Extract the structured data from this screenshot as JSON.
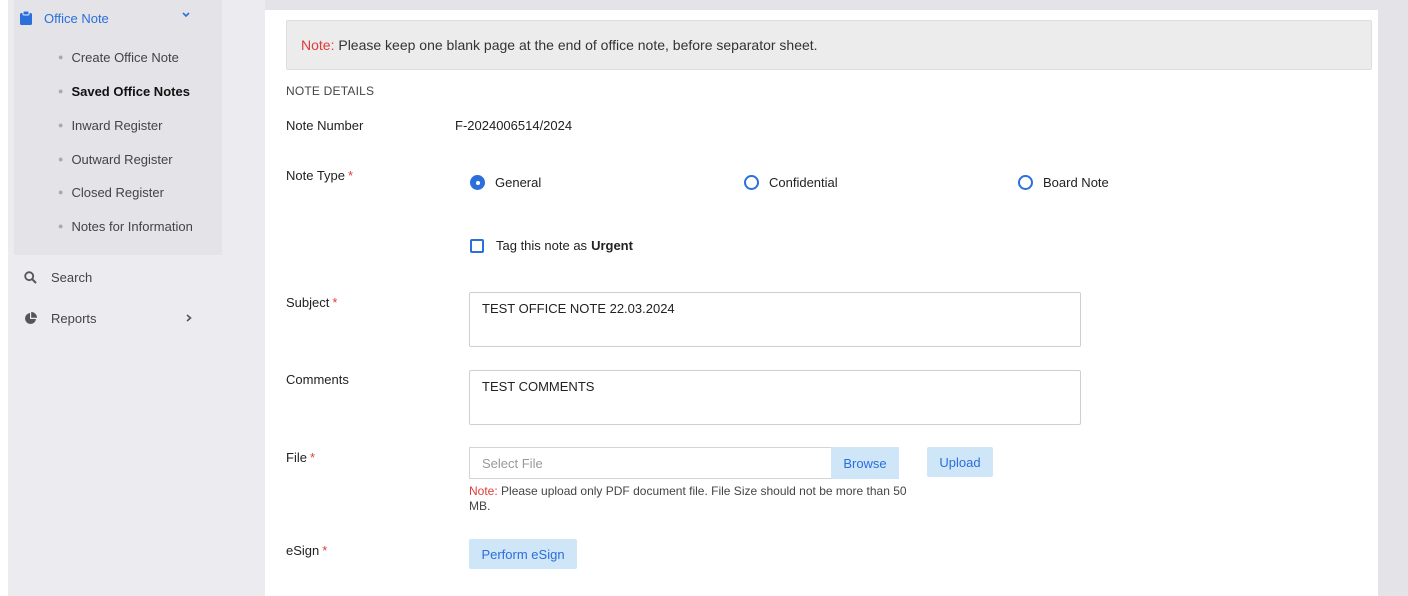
{
  "sidebar": {
    "office_note": {
      "label": "Office Note"
    },
    "sub_items": [
      {
        "label": "Create Office Note"
      },
      {
        "label": "Saved Office Notes"
      },
      {
        "label": "Inward Register"
      },
      {
        "label": "Outward Register"
      },
      {
        "label": "Closed Register"
      },
      {
        "label": "Notes for Information"
      }
    ],
    "search": {
      "label": "Search"
    },
    "reports": {
      "label": "Reports"
    }
  },
  "banner": {
    "prefix": "Note:",
    "text": " Please keep one blank page at the end of office note, before separator sheet."
  },
  "section_title": "NOTE DETAILS",
  "form": {
    "note_number": {
      "label": "Note Number",
      "value": "F-2024006514/2024"
    },
    "note_type": {
      "label": "Note Type",
      "required": "*",
      "options": [
        "General",
        "Confidential",
        "Board Note"
      ],
      "selected": "General"
    },
    "urgent": {
      "text": "Tag this note as",
      "bold": "Urgent"
    },
    "subject": {
      "label": "Subject",
      "required": "*",
      "value": "TEST OFFICE NOTE 22.03.2024"
    },
    "comments": {
      "label": "Comments",
      "value": "TEST COMMENTS"
    },
    "file": {
      "label": "File",
      "required": "*",
      "placeholder": "Select File",
      "browse_label": "Browse",
      "upload_label": "Upload",
      "note_prefix": "Note:",
      "note_text": " Please upload only PDF document file. File Size should not be more than 50 MB."
    },
    "esign": {
      "label": "eSign",
      "required": "*",
      "button_label": "Perform eSign"
    }
  },
  "colors": {
    "accent": "#2a6fdb",
    "required": "#e03a3a",
    "button_bg": "#cfe5f8"
  }
}
